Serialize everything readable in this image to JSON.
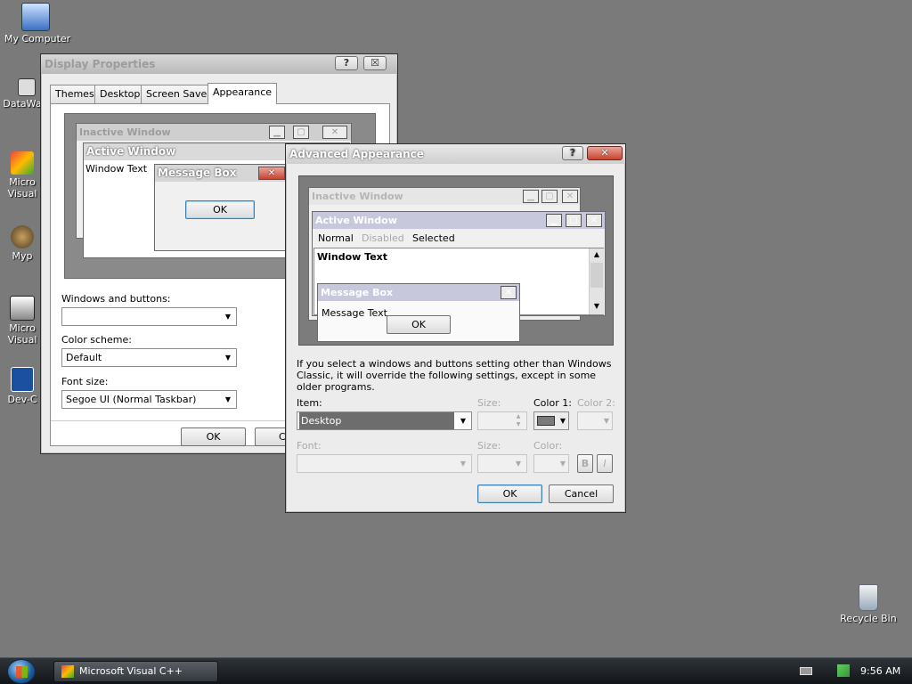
{
  "desktop": {
    "icons": [
      {
        "label": "My Computer"
      },
      {
        "label": "DataWa"
      },
      {
        "label": "Micro"
      },
      {
        "label": "Visual"
      },
      {
        "label": "Myp"
      },
      {
        "label": "Micro"
      },
      {
        "label": "Visual"
      },
      {
        "label": "Dev-C"
      },
      {
        "label": "Recycle Bin"
      }
    ]
  },
  "display_props": {
    "title": "Display Properties",
    "help_btn": "?",
    "close_btn": "☒",
    "tabs": [
      "Themes",
      "Desktop",
      "Screen Saver",
      "Appearance"
    ],
    "preview": {
      "inactive_title": "Inactive Window",
      "active_title": "Active Window",
      "window_text": "Window Text",
      "msgbox_title": "Message Box",
      "ok": "OK"
    },
    "windows_buttons_label": "Windows and buttons:",
    "windows_buttons_value": "",
    "color_scheme_label": "Color scheme:",
    "color_scheme_value": "Default",
    "font_size_label": "Font size:",
    "font_size_value": "Segoe UI (Normal Taskbar)",
    "ok": "OK",
    "cancel": "Car"
  },
  "advanced": {
    "title": "Advanced Appearance",
    "help_btn": "?",
    "close_btn": "✕",
    "preview": {
      "inactive_title": "Inactive Window",
      "active_title": "Active Window",
      "menu_normal": "Normal",
      "menu_disabled": "Disabled",
      "menu_selected": "Selected",
      "window_text": "Window Text",
      "msgbox_title": "Message Box",
      "msgbox_text": "Message Text",
      "ok": "OK"
    },
    "info": "If you select a windows and buttons setting other than Windows Classic, it will override the following settings, except in some older programs.",
    "item_label": "Item:",
    "item_value": "Desktop",
    "size_label": "Size:",
    "color1_label": "Color 1:",
    "color2_label": "Color 2:",
    "font_label": "Font:",
    "font_size_label": "Size:",
    "font_color_label": "Color:",
    "bold_btn": "B",
    "italic_btn": "I",
    "ok": "OK",
    "cancel": "Cancel"
  },
  "taskbar": {
    "task_label": "Microsoft Visual C++",
    "clock": "9:56 AM"
  },
  "colors": {
    "desktop": "#7a7a7a",
    "selected_item": "#6d6d6d",
    "color1_swatch": "#7a7a7a"
  }
}
